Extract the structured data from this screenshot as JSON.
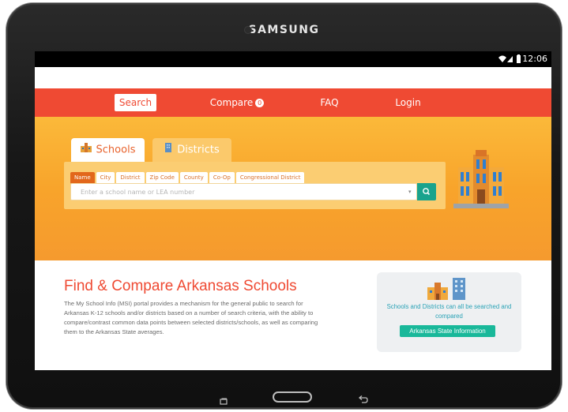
{
  "device": {
    "brand": "SAMSUNG"
  },
  "status_bar": {
    "time": "12:06",
    "icons": [
      "wifi-icon",
      "signal-icon",
      "battery-icon"
    ]
  },
  "nav": {
    "items": [
      {
        "label": "Search",
        "active": true
      },
      {
        "label": "Compare",
        "badge": "0"
      },
      {
        "label": "FAQ"
      },
      {
        "label": "Login"
      }
    ]
  },
  "search": {
    "tabs": [
      {
        "label": "Schools",
        "active": true,
        "icon": "school-building-icon"
      },
      {
        "label": "Districts",
        "active": false,
        "icon": "district-building-icon"
      }
    ],
    "filters": [
      "Name",
      "City",
      "District",
      "Zip Code",
      "County",
      "Co-Op",
      "Congressional District"
    ],
    "active_filter": "Name",
    "input_placeholder": "Enter a school name or LEA number",
    "go_icon": "search-icon"
  },
  "intro": {
    "title": "Find & Compare Arkansas Schools",
    "body": "The My School Info (MSI) portal provides a mechanism for the general public to search for Arkansas K-12 schools and/or districts based on a number of search criteria, with the ability to compare/contrast common data points between selected districts/schools, as well as comparing them to the Arkansas State averages."
  },
  "info_card": {
    "text": "Schools and Districts can all be searched and compared",
    "button_label": "Arkansas State Information"
  },
  "colors": {
    "nav_bg": "#ef4a33",
    "hero_top": "#fbb93a",
    "hero_bottom": "#f59a2e",
    "accent_teal": "#1aa38d",
    "title_red": "#ef4a33",
    "card_text": "#2aa2b6"
  }
}
